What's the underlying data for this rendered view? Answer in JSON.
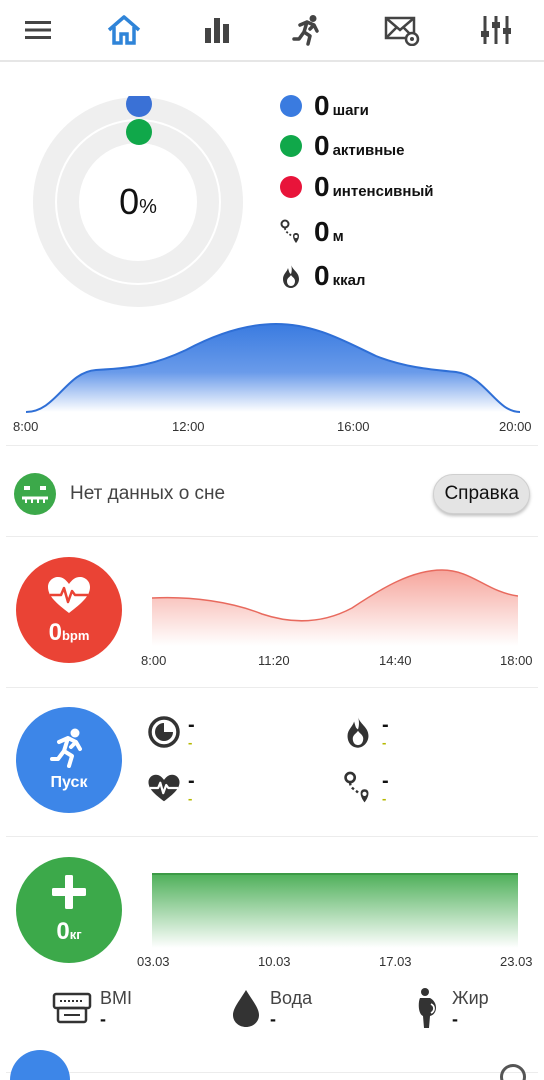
{
  "nav": {
    "items": [
      "menu-icon",
      "home-icon",
      "stats-icon",
      "running-icon",
      "mail-settings-icon",
      "equalizer-icon"
    ]
  },
  "activity": {
    "percent": "0",
    "percent_unit": "%",
    "steps": {
      "value": "0",
      "label": "шаги",
      "color": "#3a7be0"
    },
    "active": {
      "value": "0",
      "label": "активные",
      "color": "#10a84a"
    },
    "intense": {
      "value": "0",
      "label": "интенсивный",
      "color": "#e8143a"
    },
    "distance": {
      "value": "0",
      "label": "м",
      "icon": "route-icon"
    },
    "calories": {
      "value": "0",
      "label": "ккал",
      "icon": "flame-icon"
    }
  },
  "steps_chart": {
    "x_labels": [
      "8:00",
      "12:00",
      "16:00",
      "20:00"
    ]
  },
  "sleep": {
    "text": "Нет данных о сне",
    "help_label": "Справка",
    "icon": "sleep-face-icon"
  },
  "heart": {
    "value": "0",
    "unit": "bpm",
    "color": "#ea4335",
    "x_labels": [
      "8:00",
      "11:20",
      "14:40",
      "18:00"
    ]
  },
  "workout": {
    "button_label": "Пуск",
    "color": "#3d86e8",
    "stats": [
      {
        "icon": "timer-icon",
        "value": "-",
        "sub": "-"
      },
      {
        "icon": "flame-icon",
        "value": "-",
        "sub": "-"
      },
      {
        "icon": "heart-rate-icon",
        "value": "-",
        "sub": "-"
      },
      {
        "icon": "route-icon",
        "value": "-",
        "sub": "-"
      }
    ]
  },
  "weight": {
    "value": "0",
    "unit": "кг",
    "color": "#3ca94a",
    "x_labels": [
      "03.03",
      "10.03",
      "17.03",
      "23.03"
    ]
  },
  "metrics": [
    {
      "icon": "scale-icon",
      "label": "BMI",
      "value": "-"
    },
    {
      "icon": "water-drop-icon",
      "label": "Вода",
      "value": "-"
    },
    {
      "icon": "body-fat-icon",
      "label": "Жир",
      "value": "-"
    }
  ]
}
